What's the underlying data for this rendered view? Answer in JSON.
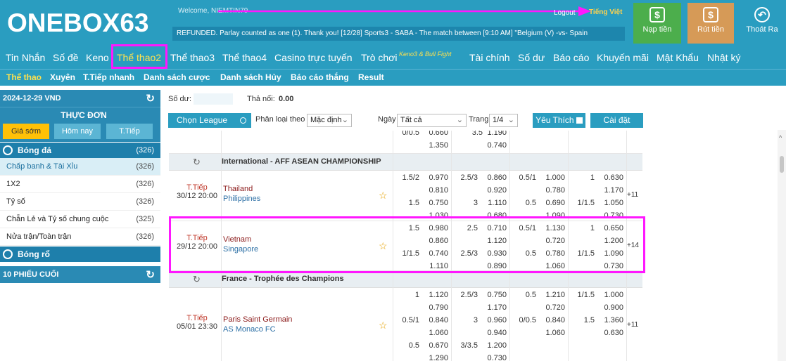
{
  "header": {
    "logo": "ONEBOX63",
    "welcome": "Welcome,  NIEMTIN79",
    "logout": "Logout",
    "language": "Tiếng Việt",
    "ticker": "REFUNDED. Parlay counted as one (1). Thank you!    [12/28] Sports3 - SABA - The match between [9:10 AM] \"Belgium (V) -vs- Spain",
    "deposit": "Nạp tiền",
    "withdraw": "Rút tiền",
    "exit": "Thoát Ra",
    "deposit_icon": "$",
    "withdraw_icon": "$",
    "exit_icon": "↶"
  },
  "nav": {
    "items": [
      "Tin Nhắn",
      "Số đề",
      "Keno",
      "Thể thao2",
      "Thể thao3",
      "Thể thao4",
      "Casino trực tuyến",
      "Trò chơi",
      "Keno3 & Bull Fight",
      "Tài chính",
      "Số dư",
      "Báo cáo",
      "Khuyến mãi",
      "Mật Khẩu",
      "Nhật ký"
    ],
    "active": "Thể thao2"
  },
  "subnav": {
    "items": [
      "Thể thao",
      "Xuyên",
      "T.Tiếp nhanh",
      "Danh sách cược",
      "Danh sách Hủy",
      "Báo cáo thắng",
      "Result"
    ]
  },
  "sidebar": {
    "date": "2024-12-29 VND",
    "menu_title": "THỰC ĐƠN",
    "tabs": [
      "Giá sớm",
      "Hôm nay",
      "T.Tiếp"
    ],
    "football": {
      "label": "Bóng đá",
      "count": "(326)"
    },
    "items": [
      {
        "label": "Chấp banh & Tài Xỉu",
        "count": "(326)"
      },
      {
        "label": "1X2",
        "count": "(326)"
      },
      {
        "label": "Tỷ số",
        "count": "(326)"
      },
      {
        "label": "Chẵn Lẻ và Tỷ số chung cuộc",
        "count": "(325)"
      },
      {
        "label": "Nửa trận/Toàn trận",
        "count": "(326)"
      }
    ],
    "basketball": {
      "label": "Bóng rổ"
    },
    "last10": "10 PHIẾU CUỐI"
  },
  "main": {
    "balance_label": "Số dư:",
    "outstanding_label": "Thả nổi:",
    "outstanding_value": "0.00",
    "choose_league": "Chọn League",
    "sort_label": "Phân loại theo",
    "sort_value": "Mặc định",
    "date_label": "Ngày",
    "date_value": "Tất cả",
    "page_label": "Trang",
    "page_value": "1/4",
    "favorites": "Yêu Thích",
    "settings": "Cài đặt"
  },
  "matches": {
    "prev_tail": {
      "r1": [
        "0/0.5",
        "0.660",
        "3.5",
        "1.190"
      ],
      "r2": [
        "",
        "1.350",
        "",
        "0.740"
      ]
    },
    "league1": "International - AFF ASEAN CHAMPIONSHIP",
    "m1": {
      "status": "T.Tiếp",
      "time": "30/12 20:00",
      "home": "Thailand",
      "away": "Philippines",
      "more": "+11",
      "rows": [
        [
          "1.5/2",
          "0.970",
          "2.5/3",
          "0.860",
          "0.5/1",
          "1.000",
          "1",
          "0.630"
        ],
        [
          "",
          "0.810",
          "",
          "0.920",
          "",
          "0.780",
          "",
          "1.170"
        ],
        [
          "1.5",
          "0.750",
          "3",
          "1.110",
          "0.5",
          "0.690",
          "1/1.5",
          "1.050"
        ],
        [
          "",
          "1.030",
          "",
          "0.680",
          "",
          "1.090",
          "",
          "0.730"
        ]
      ]
    },
    "m2": {
      "status": "T.Tiếp",
      "time": "29/12 20:00",
      "home": "Vietnam",
      "away": "Singapore",
      "more": "+14",
      "rows": [
        [
          "1.5",
          "0.980",
          "2.5",
          "0.710",
          "0.5/1",
          "1.130",
          "1",
          "0.650"
        ],
        [
          "",
          "0.860",
          "",
          "1.120",
          "",
          "0.720",
          "",
          "1.200"
        ],
        [
          "1/1.5",
          "0.740",
          "2.5/3",
          "0.930",
          "0.5",
          "0.780",
          "1/1.5",
          "1.090"
        ],
        [
          "",
          "1.110",
          "",
          "0.890",
          "",
          "1.060",
          "",
          "0.730"
        ]
      ]
    },
    "league2": "France - Trophée des Champions",
    "m3": {
      "status": "T.Tiếp",
      "time": "05/01 23:30",
      "home": "Paris Saint Germain",
      "away": "AS Monaco FC",
      "more": "+11",
      "rows": [
        [
          "1",
          "1.120",
          "2.5/3",
          "0.750",
          "0.5",
          "1.210",
          "1/1.5",
          "1.000"
        ],
        [
          "",
          "0.790",
          "",
          "1.170",
          "",
          "0.720",
          "",
          "0.900"
        ],
        [
          "0.5/1",
          "0.840",
          "3",
          "0.960",
          "0/0.5",
          "0.840",
          "1.5",
          "1.360"
        ],
        [
          "",
          "1.060",
          "",
          "0.940",
          "",
          "1.060",
          "",
          "0.630"
        ],
        [
          "0.5",
          "0.670",
          "3/3.5",
          "1.200",
          "",
          "",
          "",
          ""
        ],
        [
          "",
          "1.290",
          "",
          "0.730",
          "",
          "",
          "",
          ""
        ]
      ]
    }
  }
}
